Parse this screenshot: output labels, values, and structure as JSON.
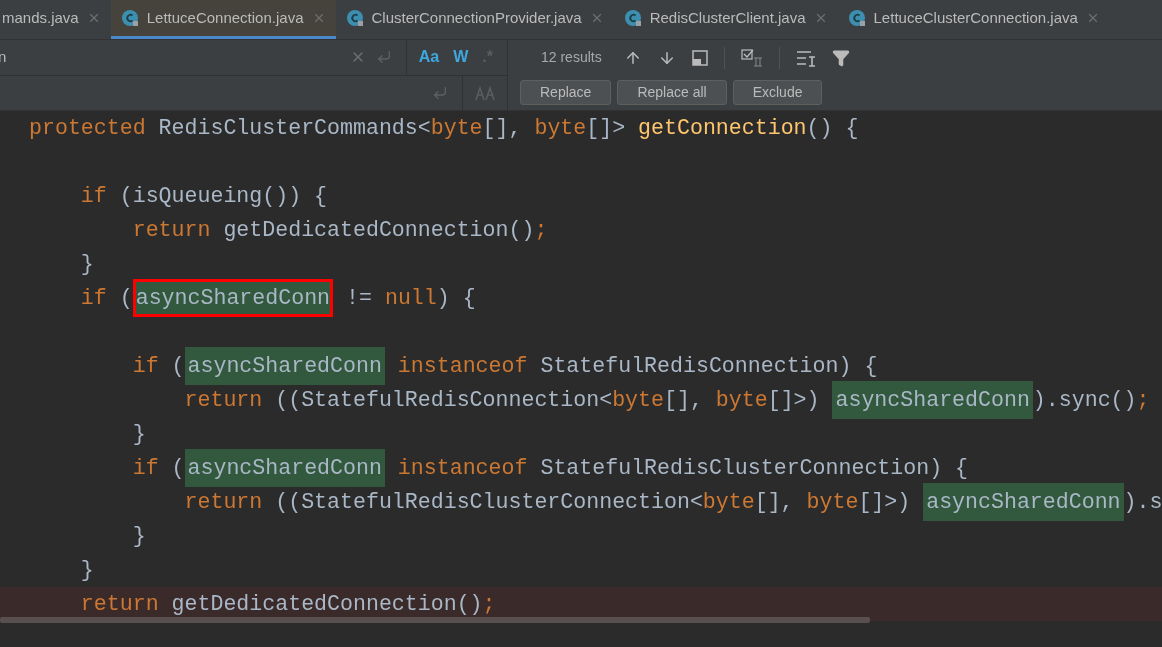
{
  "tabs": [
    {
      "label": "mands.java",
      "selected": false,
      "icon": false
    },
    {
      "label": "LettuceConnection.java",
      "selected": true,
      "icon": true
    },
    {
      "label": "ClusterConnectionProvider.java",
      "selected": false,
      "icon": true
    },
    {
      "label": "RedisClusterClient.java",
      "selected": false,
      "icon": true
    },
    {
      "label": "LettuceClusterConnection.java",
      "selected": false,
      "icon": true
    }
  ],
  "find": {
    "search_value": "n",
    "options": [
      {
        "label": "Aa",
        "selected": true
      },
      {
        "label": "W",
        "selected": true
      },
      {
        "label": ".*",
        "selected": false
      }
    ],
    "results": "12 results"
  },
  "replace_buttons": [
    "Replace",
    "Replace all",
    "Exclude"
  ],
  "code": [
    {
      "kind": "code",
      "highlighted": false,
      "tokens": [
        {
          "text": "protected ",
          "kind": "keyword"
        },
        {
          "text": "RedisClusterCommands<",
          "kind": "plain"
        },
        {
          "text": "byte",
          "kind": "keyword"
        },
        {
          "text": "[], ",
          "kind": "plain"
        },
        {
          "text": "byte",
          "kind": "keyword"
        },
        {
          "text": "[]> ",
          "kind": "plain"
        },
        {
          "text": "getConnection",
          "kind": "method"
        },
        {
          "text": "() {",
          "kind": "plain"
        }
      ]
    },
    {
      "kind": "blank",
      "highlighted": false
    },
    {
      "kind": "code",
      "highlighted": false,
      "tokens": [
        {
          "text": "    if ",
          "kind": "keyword"
        },
        {
          "text": "(isQueueing()) {",
          "kind": "plain"
        }
      ]
    },
    {
      "kind": "code",
      "highlighted": false,
      "tokens": [
        {
          "text": "        return ",
          "kind": "keyword"
        },
        {
          "text": "getDedicatedConnection()",
          "kind": "plain"
        },
        {
          "text": ";",
          "kind": "keyword"
        }
      ]
    },
    {
      "kind": "code",
      "highlighted": false,
      "tokens": [
        {
          "text": "    }",
          "kind": "plain"
        }
      ]
    },
    {
      "kind": "code",
      "highlighted": false,
      "tokens": [
        {
          "text": "    if ",
          "kind": "keyword"
        },
        {
          "text": "(",
          "kind": "plain"
        },
        {
          "text": "asyncSharedConn",
          "kind": "match",
          "current": true
        },
        {
          "text": " != ",
          "kind": "plain"
        },
        {
          "text": "null",
          "kind": "keyword"
        },
        {
          "text": ") {",
          "kind": "plain"
        }
      ]
    },
    {
      "kind": "blank",
      "highlighted": false
    },
    {
      "kind": "code",
      "highlighted": false,
      "tokens": [
        {
          "text": "        if ",
          "kind": "keyword"
        },
        {
          "text": "(",
          "kind": "plain"
        },
        {
          "text": "asyncSharedConn",
          "kind": "match",
          "current": false
        },
        {
          "text": " instanceof ",
          "kind": "keyword"
        },
        {
          "text": "StatefulRedisConnection) {",
          "kind": "plain"
        }
      ]
    },
    {
      "kind": "code",
      "highlighted": false,
      "tokens": [
        {
          "text": "            return ",
          "kind": "keyword"
        },
        {
          "text": "((StatefulRedisConnection<",
          "kind": "plain"
        },
        {
          "text": "byte",
          "kind": "keyword"
        },
        {
          "text": "[], ",
          "kind": "plain"
        },
        {
          "text": "byte",
          "kind": "keyword"
        },
        {
          "text": "[]>) ",
          "kind": "plain"
        },
        {
          "text": "asyncSharedConn",
          "kind": "match",
          "current": false
        },
        {
          "text": ").sync()",
          "kind": "plain"
        },
        {
          "text": ";",
          "kind": "keyword"
        }
      ]
    },
    {
      "kind": "code",
      "highlighted": false,
      "tokens": [
        {
          "text": "        }",
          "kind": "plain"
        }
      ]
    },
    {
      "kind": "code",
      "highlighted": false,
      "tokens": [
        {
          "text": "        if ",
          "kind": "keyword"
        },
        {
          "text": "(",
          "kind": "plain"
        },
        {
          "text": "asyncSharedConn",
          "kind": "match",
          "current": false
        },
        {
          "text": " instanceof ",
          "kind": "keyword"
        },
        {
          "text": "StatefulRedisClusterConnection) {",
          "kind": "plain"
        }
      ]
    },
    {
      "kind": "code",
      "highlighted": false,
      "tokens": [
        {
          "text": "            return ",
          "kind": "keyword"
        },
        {
          "text": "((StatefulRedisClusterConnection<",
          "kind": "plain"
        },
        {
          "text": "byte",
          "kind": "keyword"
        },
        {
          "text": "[], ",
          "kind": "plain"
        },
        {
          "text": "byte",
          "kind": "keyword"
        },
        {
          "text": "[]>) ",
          "kind": "plain"
        },
        {
          "text": "asyncSharedConn",
          "kind": "match",
          "current": false
        },
        {
          "text": ").s",
          "kind": "plain"
        }
      ]
    },
    {
      "kind": "code",
      "highlighted": false,
      "tokens": [
        {
          "text": "        }",
          "kind": "plain"
        }
      ]
    },
    {
      "kind": "code",
      "highlighted": false,
      "tokens": [
        {
          "text": "    }",
          "kind": "plain"
        }
      ]
    },
    {
      "kind": "code",
      "highlighted": true,
      "tokens": [
        {
          "text": "    return ",
          "kind": "keyword"
        },
        {
          "text": "getDedicatedConnection()",
          "kind": "plain"
        },
        {
          "text": ";",
          "kind": "keyword"
        }
      ]
    }
  ]
}
